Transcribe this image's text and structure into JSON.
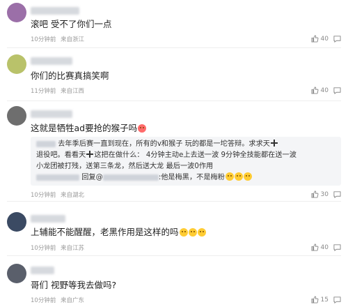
{
  "comments": [
    {
      "text": "滚吧 受不了你们一点",
      "time": "10分钟前",
      "location": "来自浙江",
      "likes": "40"
    },
    {
      "text": "你们的比赛真搞笑啊",
      "time": "11分钟前",
      "location": "来自江西",
      "likes": "40"
    },
    {
      "text": "这就是牺牲ad要抢的猴子吗",
      "time": "10分钟前",
      "location": "来自湖北",
      "likes": "30",
      "quote": {
        "line1_a": "去年季后赛一直到现在，所有的v和猴子 玩的都是一坨答辩。求求天",
        "line2": "退役吧。看看天",
        "line2_b": "这把在做什么： 4分钟主动e上去送一波 9分钟全技能都在送一波",
        "line3": "小龙团被打残，送第三条龙，然后送大龙 最后一波0作用",
        "line4_a": "回复@",
        "line4_b": ":他是梅黑，不是梅粉"
      }
    },
    {
      "text": "上辅能不能醒醒，老黑作用是这样的吗",
      "time": "10分钟前",
      "location": "来自江苏",
      "likes": "40"
    },
    {
      "text": "哥们 视野等我去做吗?",
      "time": "10分钟前",
      "location": "来自广东",
      "likes": "15"
    }
  ],
  "colors": {
    "avatar1": "#9b6fa8",
    "avatar2": "#b9c26a",
    "avatar3": "#6e6e6e",
    "avatar4": "#3b4a63",
    "avatar5": "#5a5f6b"
  },
  "icons": [
    "thumbs-up-icon",
    "comment-icon"
  ]
}
